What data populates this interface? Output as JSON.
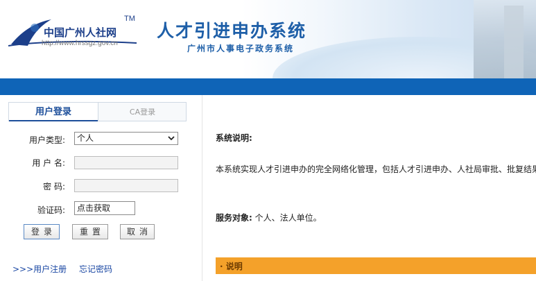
{
  "header": {
    "logo_text": "中国广州人社网",
    "logo_tm": "TM",
    "logo_url": "http://www.hrssgz.gov.cn",
    "title": "人才引进申办系统",
    "subtitle": "广州市人事电子政务系统"
  },
  "login": {
    "tab_user": "用户登录",
    "tab_ca": "CA登录",
    "user_type_label": "用户类型:",
    "user_type_value": "个人",
    "username_label": "用 户 名:",
    "password_label": "密  码:",
    "captcha_label": "验证码:",
    "captcha_value": "点击获取",
    "btn_login": "登录",
    "btn_reset": "重置",
    "btn_cancel": "取消",
    "link_register": ">>>用户注册",
    "link_forgot": "忘记密码"
  },
  "content": {
    "heading": "系统说明:",
    "description": "本系统实现人才引进申办的完全网络化管理，包括人才引进申办、人社局审批、批复结果",
    "target_label": "服务对象:",
    "target_value": " 个人、法人单位。",
    "section_title": "· 说明"
  },
  "colors": {
    "nav_bar": "#0f64b7",
    "accent_orange": "#f4a12a",
    "title_blue": "#1e5fa8"
  }
}
